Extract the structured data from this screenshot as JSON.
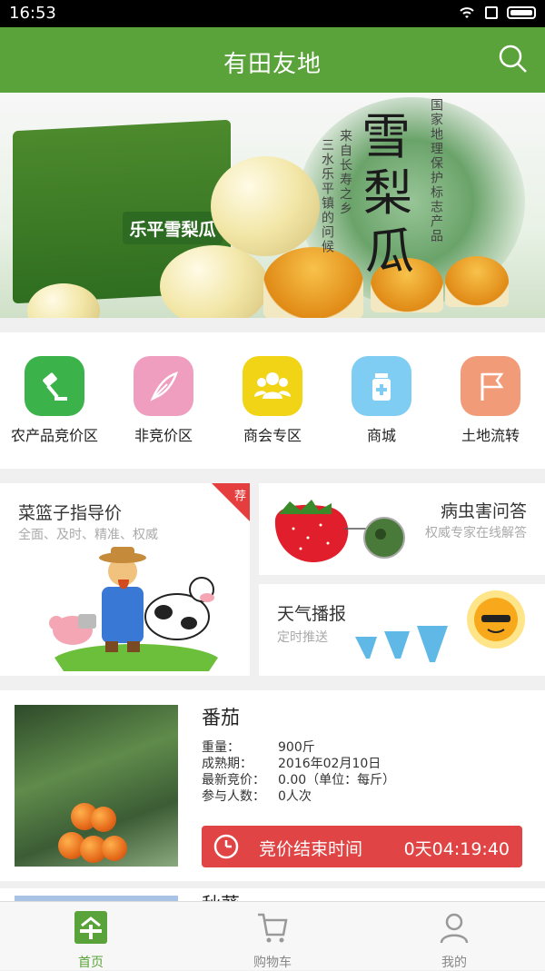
{
  "status_bar": {
    "time": "16:53"
  },
  "header": {
    "title": "有田友地",
    "search_icon": "search-icon"
  },
  "banner": {
    "box_label": "乐平雪梨瓜",
    "big_text_1": "雪",
    "big_text_2": "梨",
    "big_text_3": "瓜",
    "side_text_1": "国家地理保护标志产品",
    "side_text_2": "来自长寿之乡",
    "side_text_3": "三水乐平镇的问候",
    "dots_total": 4,
    "dots_active_index": 0
  },
  "categories": [
    {
      "label": "农产品竞价区",
      "icon": "gavel-icon",
      "color": "#3bb24a"
    },
    {
      "label": "非竞价区",
      "icon": "feather-icon",
      "color": "#f09ec0"
    },
    {
      "label": "商会专区",
      "icon": "people-icon",
      "color": "#f2d417"
    },
    {
      "label": "商城",
      "icon": "bottle-icon",
      "color": "#7fcdf2"
    },
    {
      "label": "土地流转",
      "icon": "flag-icon",
      "color": "#f29b78"
    }
  ],
  "cards": {
    "basket": {
      "title": "菜篮子指导价",
      "subtitle": "全面、及时、精准、权威",
      "badge": "荐"
    },
    "pest": {
      "title": "病虫害问答",
      "subtitle": "权威专家在线解答"
    },
    "weather": {
      "title": "天气播报",
      "subtitle": "定时推送"
    }
  },
  "product": {
    "name": "番茄",
    "rows": [
      {
        "key": "重量：",
        "value": "900斤"
      },
      {
        "key": "成熟期：",
        "value": "2016年02月10日"
      },
      {
        "key": "最新竞价：",
        "value": "0.00（单位：每斤）"
      },
      {
        "key": "参与人数：",
        "value": "0人次"
      }
    ],
    "bid_label": "竞价结束时间",
    "countdown": "0天04:19:40"
  },
  "product2": {
    "name": "秋葵"
  },
  "tabbar": [
    {
      "label": "首页",
      "icon": "home-icon",
      "active": true
    },
    {
      "label": "购物车",
      "icon": "cart-icon",
      "active": false
    },
    {
      "label": "我的",
      "icon": "user-icon",
      "active": false
    }
  ],
  "colors": {
    "brand_green": "#5aa33a",
    "alert_red": "#e04444"
  }
}
